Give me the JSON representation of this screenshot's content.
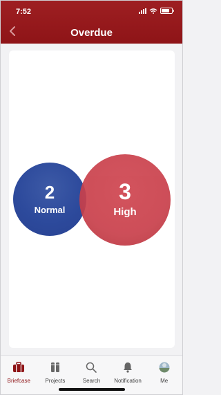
{
  "status_bar": {
    "time": "7:52"
  },
  "header": {
    "title": "Overdue",
    "back_icon": "chevron-left-icon"
  },
  "bubbles": [
    {
      "count": "2",
      "label": "Normal",
      "color": "#2d4a9c"
    },
    {
      "count": "3",
      "label": "High",
      "color": "#c9404b"
    }
  ],
  "tabs": [
    {
      "label": "Briefcase",
      "icon": "briefcase-icon",
      "active": true
    },
    {
      "label": "Projects",
      "icon": "projects-icon",
      "active": false
    },
    {
      "label": "Search",
      "icon": "search-icon",
      "active": false
    },
    {
      "label": "Notification",
      "icon": "bell-icon",
      "active": false
    },
    {
      "label": "Me",
      "icon": "avatar-icon",
      "active": false
    }
  ],
  "colors": {
    "brand": "#8e1417",
    "background": "#f2f2f4"
  }
}
